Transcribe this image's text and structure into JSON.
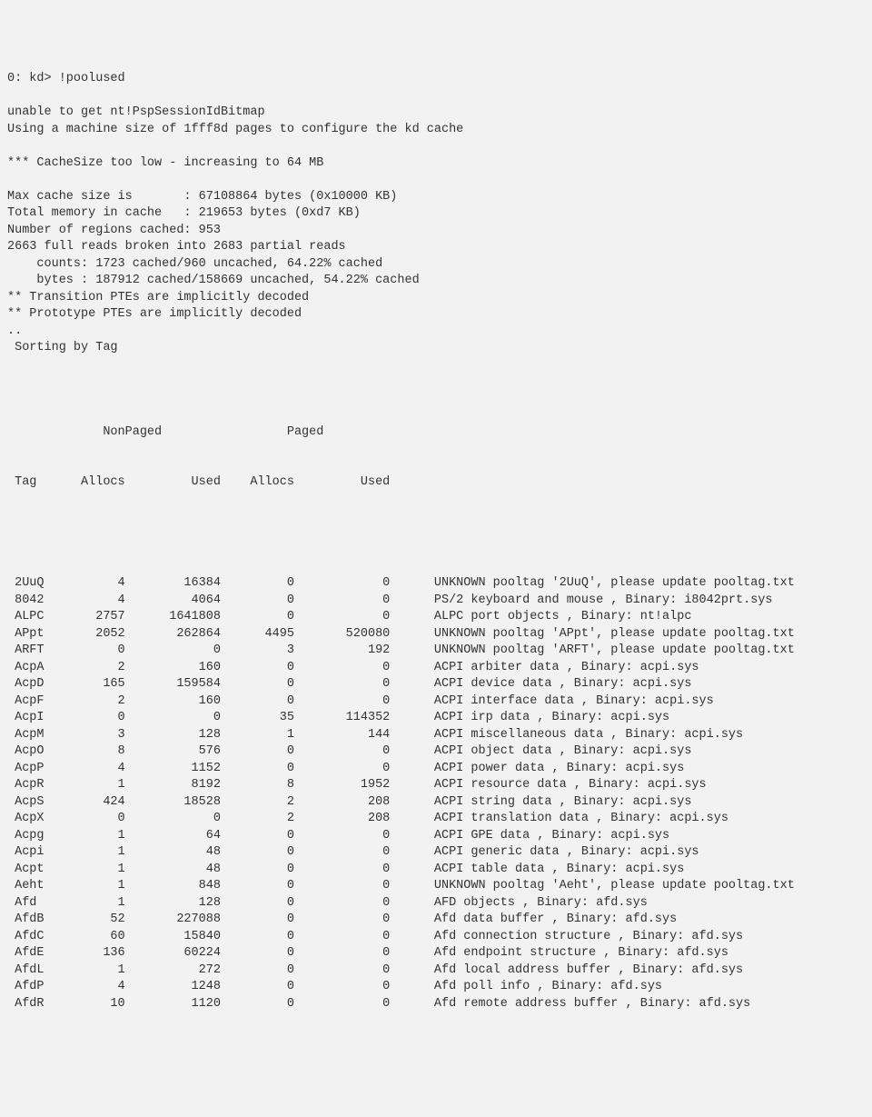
{
  "prompt": {
    "line": "0: kd> !poolused"
  },
  "preamble": {
    "lines": [
      "unable to get nt!PspSessionIdBitmap",
      "Using a machine size of 1fff8d pages to configure the kd cache",
      "",
      "*** CacheSize too low - increasing to 64 MB",
      "",
      "Max cache size is       : 67108864 bytes (0x10000 KB)",
      "Total memory in cache   : 219653 bytes (0xd7 KB)",
      "Number of regions cached: 953",
      "2663 full reads broken into 2683 partial reads",
      "    counts: 1723 cached/960 uncached, 64.22% cached",
      "    bytes : 187912 cached/158669 uncached, 54.22% cached",
      "** Transition PTEs are implicitly decoded",
      "** Prototype PTEs are implicitly decoded",
      "..",
      " Sorting by Tag",
      ""
    ]
  },
  "table": {
    "header1": {
      "nonpaged": "NonPaged",
      "paged": "Paged"
    },
    "header2": {
      "tag": "Tag",
      "allocs1": "Allocs",
      "used1": "Used",
      "allocs2": "Allocs",
      "used2": "Used"
    },
    "rows": [
      {
        "tag": "2UuQ",
        "np_alloc": "4",
        "np_used": "16384",
        "p_alloc": "0",
        "p_used": "0",
        "desc": "UNKNOWN pooltag '2UuQ', please update pooltag.txt"
      },
      {
        "tag": "8042",
        "np_alloc": "4",
        "np_used": "4064",
        "p_alloc": "0",
        "p_used": "0",
        "desc": "PS/2 keyboard and mouse , Binary: i8042prt.sys"
      },
      {
        "tag": "ALPC",
        "np_alloc": "2757",
        "np_used": "1641808",
        "p_alloc": "0",
        "p_used": "0",
        "desc": "ALPC port objects , Binary: nt!alpc"
      },
      {
        "tag": "APpt",
        "np_alloc": "2052",
        "np_used": "262864",
        "p_alloc": "4495",
        "p_used": "520080",
        "desc": "UNKNOWN pooltag 'APpt', please update pooltag.txt"
      },
      {
        "tag": "ARFT",
        "np_alloc": "0",
        "np_used": "0",
        "p_alloc": "3",
        "p_used": "192",
        "desc": "UNKNOWN pooltag 'ARFT', please update pooltag.txt"
      },
      {
        "tag": "AcpA",
        "np_alloc": "2",
        "np_used": "160",
        "p_alloc": "0",
        "p_used": "0",
        "desc": "ACPI arbiter data , Binary: acpi.sys"
      },
      {
        "tag": "AcpD",
        "np_alloc": "165",
        "np_used": "159584",
        "p_alloc": "0",
        "p_used": "0",
        "desc": "ACPI device data , Binary: acpi.sys"
      },
      {
        "tag": "AcpF",
        "np_alloc": "2",
        "np_used": "160",
        "p_alloc": "0",
        "p_used": "0",
        "desc": "ACPI interface data , Binary: acpi.sys"
      },
      {
        "tag": "AcpI",
        "np_alloc": "0",
        "np_used": "0",
        "p_alloc": "35",
        "p_used": "114352",
        "desc": "ACPI irp data , Binary: acpi.sys"
      },
      {
        "tag": "AcpM",
        "np_alloc": "3",
        "np_used": "128",
        "p_alloc": "1",
        "p_used": "144",
        "desc": "ACPI miscellaneous data , Binary: acpi.sys"
      },
      {
        "tag": "AcpO",
        "np_alloc": "8",
        "np_used": "576",
        "p_alloc": "0",
        "p_used": "0",
        "desc": "ACPI object data , Binary: acpi.sys"
      },
      {
        "tag": "AcpP",
        "np_alloc": "4",
        "np_used": "1152",
        "p_alloc": "0",
        "p_used": "0",
        "desc": "ACPI power data , Binary: acpi.sys"
      },
      {
        "tag": "AcpR",
        "np_alloc": "1",
        "np_used": "8192",
        "p_alloc": "8",
        "p_used": "1952",
        "desc": "ACPI resource data , Binary: acpi.sys"
      },
      {
        "tag": "AcpS",
        "np_alloc": "424",
        "np_used": "18528",
        "p_alloc": "2",
        "p_used": "208",
        "desc": "ACPI string data , Binary: acpi.sys"
      },
      {
        "tag": "AcpX",
        "np_alloc": "0",
        "np_used": "0",
        "p_alloc": "2",
        "p_used": "208",
        "desc": "ACPI translation data , Binary: acpi.sys"
      },
      {
        "tag": "Acpg",
        "np_alloc": "1",
        "np_used": "64",
        "p_alloc": "0",
        "p_used": "0",
        "desc": "ACPI GPE data , Binary: acpi.sys"
      },
      {
        "tag": "Acpi",
        "np_alloc": "1",
        "np_used": "48",
        "p_alloc": "0",
        "p_used": "0",
        "desc": "ACPI generic data , Binary: acpi.sys"
      },
      {
        "tag": "Acpt",
        "np_alloc": "1",
        "np_used": "48",
        "p_alloc": "0",
        "p_used": "0",
        "desc": "ACPI table data , Binary: acpi.sys"
      },
      {
        "tag": "Aeht",
        "np_alloc": "1",
        "np_used": "848",
        "p_alloc": "0",
        "p_used": "0",
        "desc": "UNKNOWN pooltag 'Aeht', please update pooltag.txt"
      },
      {
        "tag": "Afd ",
        "np_alloc": "1",
        "np_used": "128",
        "p_alloc": "0",
        "p_used": "0",
        "desc": "AFD objects , Binary: afd.sys"
      },
      {
        "tag": "AfdB",
        "np_alloc": "52",
        "np_used": "227088",
        "p_alloc": "0",
        "p_used": "0",
        "desc": "Afd data buffer , Binary: afd.sys"
      },
      {
        "tag": "AfdC",
        "np_alloc": "60",
        "np_used": "15840",
        "p_alloc": "0",
        "p_used": "0",
        "desc": "Afd connection structure , Binary: afd.sys"
      },
      {
        "tag": "AfdE",
        "np_alloc": "136",
        "np_used": "60224",
        "p_alloc": "0",
        "p_used": "0",
        "desc": "Afd endpoint structure , Binary: afd.sys"
      },
      {
        "tag": "AfdL",
        "np_alloc": "1",
        "np_used": "272",
        "p_alloc": "0",
        "p_used": "0",
        "desc": "Afd local address buffer , Binary: afd.sys"
      },
      {
        "tag": "AfdP",
        "np_alloc": "4",
        "np_used": "1248",
        "p_alloc": "0",
        "p_used": "0",
        "desc": "Afd poll info , Binary: afd.sys"
      },
      {
        "tag": "AfdR",
        "np_alloc": "10",
        "np_used": "1120",
        "p_alloc": "0",
        "p_used": "0",
        "desc": "Afd remote address buffer , Binary: afd.sys"
      }
    ]
  },
  "col_widths": {
    "tag": 5,
    "np_alloc": 10,
    "np_used": 13,
    "p_alloc": 10,
    "p_used": 13,
    "desc_gap": 6
  }
}
